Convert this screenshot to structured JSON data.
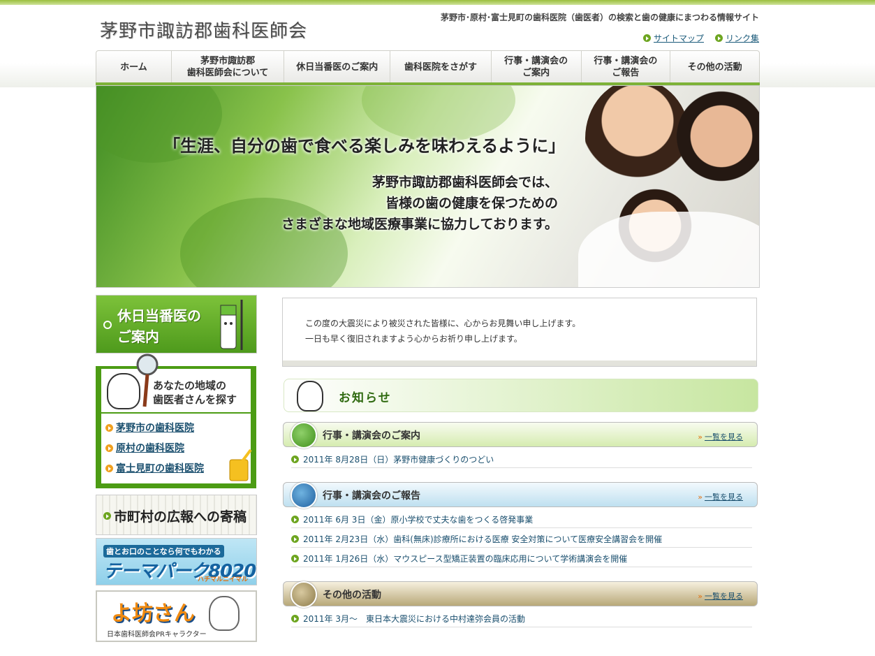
{
  "header": {
    "site_title": "茅野市諏訪郡歯科医師会",
    "tagline": "茅野市･原村･富士見町の歯科医院（歯医者）の検索と歯の健康にまつわる情報サイト",
    "links": [
      "サイトマップ",
      "リンク集"
    ]
  },
  "nav": {
    "items": [
      {
        "label": "ホーム"
      },
      {
        "label": "茅野市諏訪郡\n歯科医師会について"
      },
      {
        "label": "休日当番医のご案内"
      },
      {
        "label": "歯科医院をさがす"
      },
      {
        "label": "行事・講演会の\nご案内"
      },
      {
        "label": "行事・講演会の\nご報告"
      },
      {
        "label": "その他の活動"
      }
    ]
  },
  "hero": {
    "headline": "「生涯、自分の歯で食べる楽しみを味わえるように」",
    "line1": "茅野市諏訪郡歯科医師会では、",
    "line2": "皆様の歯の健康を保つための",
    "line3": "さまざまな地域医療事業に協力しております。"
  },
  "sidebar": {
    "holiday_banner": "休日当番医の\nご案内",
    "finder_heading": "あなたの地域の\n歯医者さんを探す",
    "finder_links": [
      "茅野市の歯科医院",
      "原村の歯科医院",
      "富士見町の歯科医院"
    ],
    "pr_banner": "市町村の広報への寄稿",
    "themepark_small": "歯とお口のことなら何でもわかる",
    "themepark_big": "テーマパーク8020",
    "themepark_sub": "ハチマルニイマル",
    "yobo_big": "よ坊さん",
    "yobo_sub": "日本歯科医師会PRキャラクター"
  },
  "notice": {
    "line1": "この度の大震災により被災された皆様に、心からお見舞い申し上げます。",
    "line2": "一日も早く復旧されますよう心からお祈り申し上げます。"
  },
  "news": {
    "heading": "お知らせ",
    "more_label": "一覧を見る",
    "sections": [
      {
        "title": "行事・講演会のご案内",
        "entries": [
          "2011年 8月28日（日）茅野市健康づくりのつどい"
        ]
      },
      {
        "title": "行事・講演会のご報告",
        "entries": [
          "2011年 6月 3日（金）原小学校で丈夫な歯をつくる啓発事業",
          "2011年 2月23日（水）歯科(無床)診療所における医療 安全対策について医療安全講習会を開催",
          "2011年 1月26日（水）マウスピース型矯正装置の臨床応用について学術講演会を開催"
        ]
      },
      {
        "title": "その他の活動",
        "entries": [
          "2011年 3月～　東日本大震災における中村達弥会員の活動"
        ]
      }
    ]
  }
}
